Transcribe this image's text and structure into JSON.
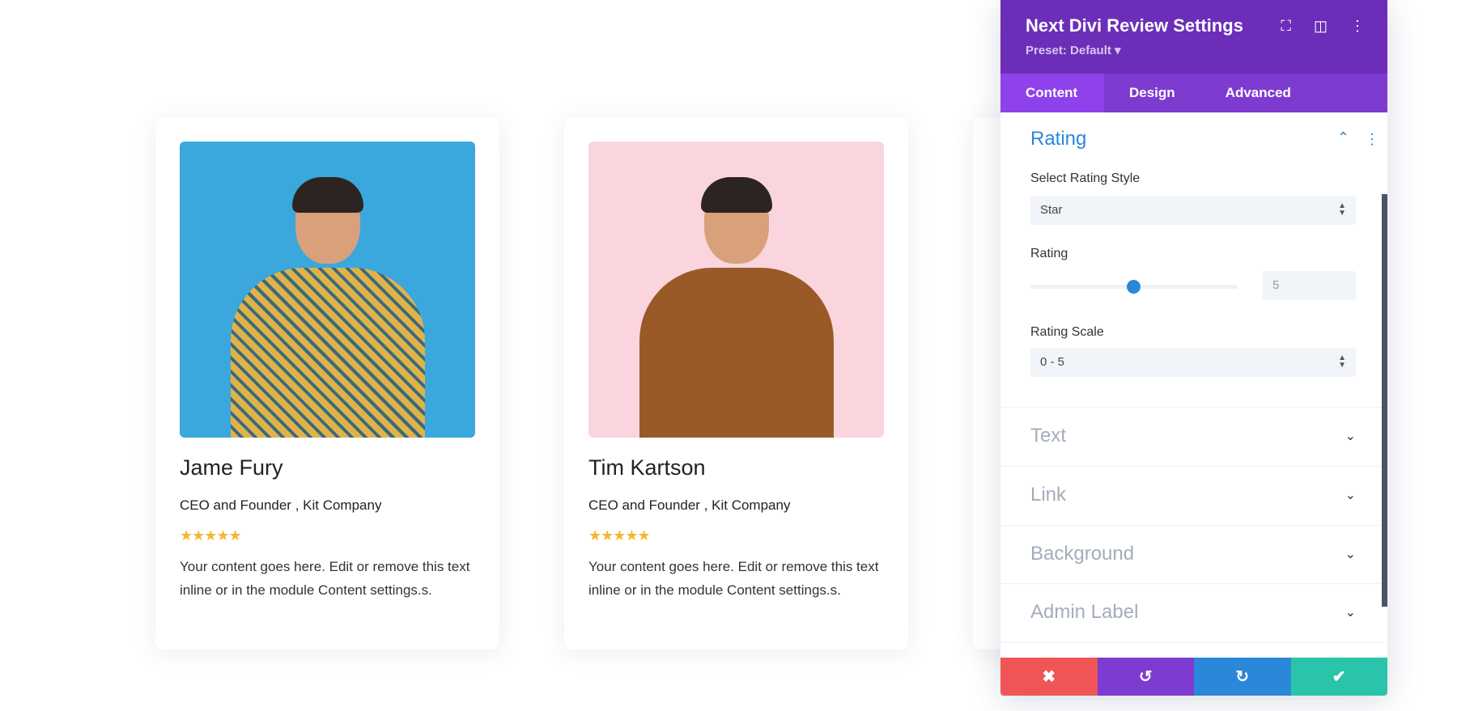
{
  "cards": [
    {
      "name": "Jame Fury",
      "role": "CEO and Founder , Kit Company",
      "stars": "★★★★★",
      "text": "Your content goes here. Edit or remove this text inline or in the module Content settings.s.",
      "photo_bg": "#3aa8dc"
    },
    {
      "name": "Tim Kartson",
      "role": "CEO and Founder , Kit Company",
      "stars": "★★★★★",
      "text": "Your content goes here. Edit or remove this text inline or in the module Content settings.s.",
      "photo_bg": "#fbd5de"
    }
  ],
  "panel": {
    "title": "Next Divi Review Settings",
    "preset": "Preset: Default ▾",
    "icons": [
      "focus-icon",
      "sidebar-layout-icon",
      "more-vertical-icon"
    ],
    "tabs": [
      "Content",
      "Design",
      "Advanced"
    ],
    "rating_section": {
      "title": "Rating",
      "style_label": "Select Rating Style",
      "style_value": "Star",
      "rating_label": "Rating",
      "rating_value": "5",
      "rating_slider_fraction": 0.5,
      "scale_label": "Rating Scale",
      "scale_value": "0 - 5"
    },
    "sections": [
      "Text",
      "Link",
      "Background",
      "Admin Label"
    ],
    "footer_icons": [
      "close-icon",
      "undo-icon",
      "redo-icon",
      "check-icon"
    ],
    "colors": {
      "header": "#6c2eb9",
      "tabs": "#7e3bd0",
      "accent": "#2b87da",
      "cancel": "#ef5555",
      "undo": "#7e3bd0",
      "redo": "#2b87da",
      "save": "#29c4a9"
    }
  }
}
